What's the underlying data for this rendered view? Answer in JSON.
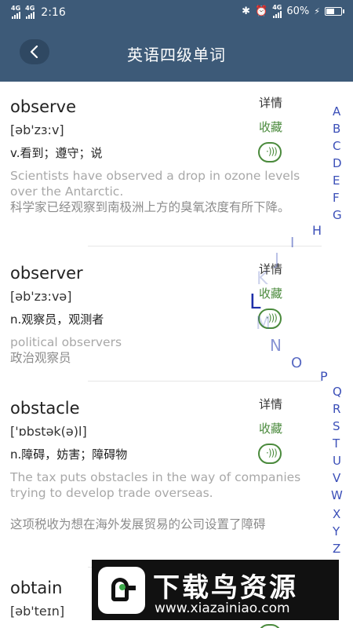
{
  "status_bar": {
    "network_1": "4G",
    "network_2": "4G",
    "time": "2:16",
    "network_3": "4G",
    "battery_percent": "60%",
    "battery_level": 0.6,
    "icons": [
      "bluetooth-icon",
      "alarm-icon",
      "charging-icon"
    ]
  },
  "header": {
    "title": "英语四级单词",
    "back_icon": "chevron-left-icon"
  },
  "entries": [
    {
      "word": "observe",
      "phonetic": "[əb'zɜ:v]",
      "meaning": "v.看到；遵守；说",
      "example_en": "Scientists have observed a drop in ozone levels over the Antarctic.",
      "example_cn": "科学家已经观察到南极洲上方的臭氧浓度有所下降。",
      "detail_label": "详情",
      "favorite_label": "收藏"
    },
    {
      "word": "observer",
      "phonetic": "[əb'zɜ:və]",
      "meaning": "n.观察员，观测者",
      "example_en": "political observers",
      "example_cn": "政治观察员",
      "detail_label": "详情",
      "favorite_label": "收藏"
    },
    {
      "word": "obstacle",
      "phonetic": "['ɒbstək(ə)l]",
      "meaning": "n.障碍，妨害；障碍物",
      "example_en": "The tax puts obstacles in the way of companies trying to develop trade overseas.",
      "example_cn": "这项税收为想在海外发展贸易的公司设置了障碍",
      "detail_label": "详情",
      "favorite_label": "收藏"
    },
    {
      "word": "obtain",
      "phonetic": "[əb'teɪn]"
    }
  ],
  "alphabet_index": [
    "A",
    "B",
    "C",
    "D",
    "E",
    "F",
    "G",
    "H",
    "I",
    "J",
    "K",
    "L",
    "M",
    "N",
    "O",
    "P",
    "Q",
    "R",
    "S",
    "T",
    "U",
    "V",
    "W",
    "X",
    "Y",
    "Z"
  ],
  "watermark": {
    "name": "下载鸟资源",
    "url": "www.xiazainiao.com"
  },
  "colors": {
    "header_bg": "#3d5a78",
    "favorite_green": "#4a8a3c",
    "index_blue": "#3b4fb8"
  }
}
